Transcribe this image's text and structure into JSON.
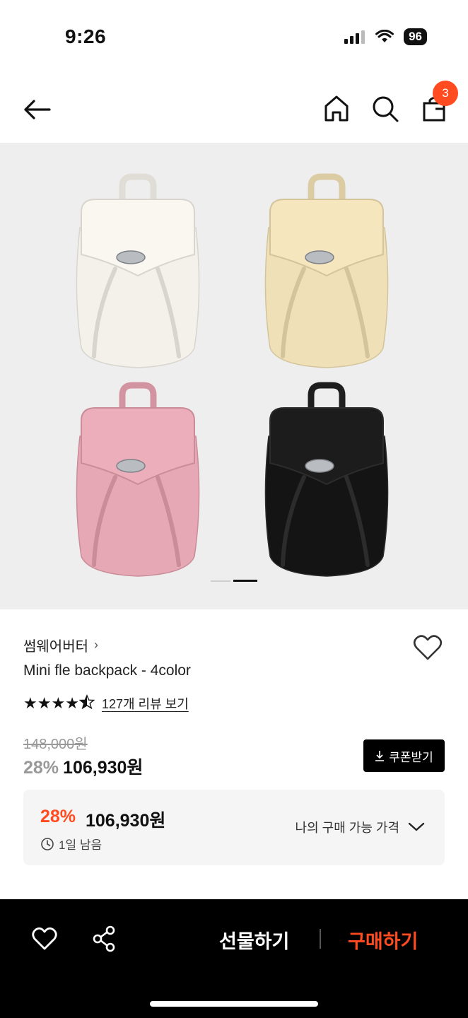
{
  "status_bar": {
    "time": "9:26",
    "battery": "96"
  },
  "header": {
    "cart_count": "3"
  },
  "gallery": {
    "bag_colors": [
      "#f4f1ea",
      "#efe0b8",
      "#e6a8b4",
      "#141414"
    ],
    "active_index": 1,
    "total": 2
  },
  "product": {
    "brand": "썸웨어버터",
    "name": "Mini fle backpack - 4color",
    "rating": 4.5,
    "review_link": "127개 리뷰 보기",
    "original_price": "148,000원",
    "discount_rate": "28%",
    "sale_price": "106,930원",
    "coupon_label": "쿠폰받기"
  },
  "best_price": {
    "rate": "28%",
    "price": "106,930원",
    "time_left": "1일 남음",
    "label": "나의 구매 가능 가격"
  },
  "bottom_bar": {
    "gift_label": "선물하기",
    "buy_label": "구매하기",
    "accent": "#ff4b1f"
  }
}
